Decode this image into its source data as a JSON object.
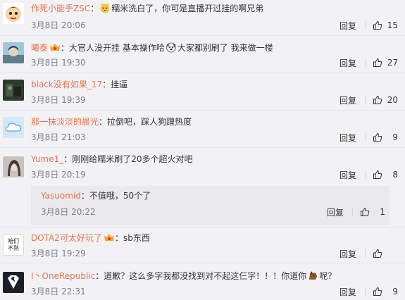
{
  "ui": {
    "reply_label": "回复"
  },
  "comments": [
    {
      "avatar": "crayon-shin-chan-avatar",
      "username": "作死小能手ZSC",
      "sep": "：",
      "emoji_before": "cat-face-emoji",
      "content": "糯米洗白了，你可是直播开过挂的啊兄弟",
      "date": "3月8日 20:06",
      "likes": "15"
    },
    {
      "avatar": "anime-character-avatar",
      "username": "曦泰",
      "badge": "vip-badge",
      "sep": "：",
      "content_a": "大官人没开挂 基本操作哈",
      "emoji_mid": "dog-face-emoji",
      "content_b": "大家都别刷了 我来做一楼",
      "date": "3月8日 19:30",
      "likes": "27"
    },
    {
      "avatar": "dark-photo-avatar",
      "username": "black没有如果_17",
      "sep": "：",
      "content": "挂逼",
      "date": "3月8日 19:39",
      "likes": "20"
    },
    {
      "avatar": "cloud-default-avatar",
      "username": "那一抹淡淡的晨光",
      "sep": "：",
      "content": "拉倒吧，踩人狗蹭热度",
      "date": "3月8日 21:03",
      "likes": "9"
    },
    {
      "avatar": "girl-photo-avatar",
      "username": "Yume1_",
      "sep": "：",
      "content": "刚刚给糯米刷了20多个超火对吧",
      "date": "3月8日 20:19",
      "likes": "8"
    },
    {
      "nested": true,
      "username": "Yasuomid",
      "sep": "：",
      "content": "不值哦，50个了",
      "date": "3月8日 20:22",
      "likes": "1"
    },
    {
      "avatar": "text-avatar",
      "avatar_text": [
        "咱们",
        "不熟"
      ],
      "username": "DOTA2可太好玩了",
      "badge": "vip-badge",
      "sep": "：",
      "content": "sb东西",
      "date": "3月8日 19:29",
      "likes": ""
    },
    {
      "avatar": "superman-logo-avatar",
      "username": "I丶OneRepublic",
      "sep": "：",
      "content_a": "道歉？这么多字我都没找到对不起这仨字！！！你道你",
      "emoji_mid": "horse-face-emoji",
      "content_b": "呢？",
      "date": "3月8日 22:31",
      "likes": "9"
    }
  ],
  "colors": {
    "username": "#eb7350",
    "meta": "#808080",
    "background": "#f2f2f5"
  }
}
